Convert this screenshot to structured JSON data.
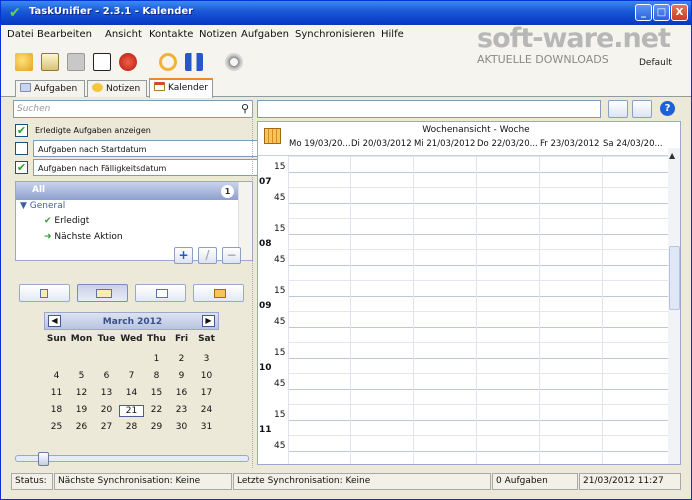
{
  "window": {
    "title": "TaskUnifier - 2.3.1 - Kalender",
    "buttons": [
      "_",
      "□",
      "X"
    ]
  },
  "menu": [
    "Datei",
    "Bearbeiten",
    "Ansicht",
    "Kontakte",
    "Notizen",
    "Aufgaben",
    "Synchronisieren",
    "Hilfe"
  ],
  "brand": {
    "logo": "soft-ware.net",
    "subtitle": "AKTUELLE DOWNLOADS",
    "profile": "Default"
  },
  "toolbar": {
    "icons": [
      "add-task-icon",
      "add-note-icon",
      "copy-icon",
      "edit-icon",
      "delete-icon",
      "sync-icon",
      "pause-icon",
      "settings-icon"
    ]
  },
  "tabs": [
    {
      "label": "Aufgaben"
    },
    {
      "label": "Notizen"
    },
    {
      "label": "Kalender"
    }
  ],
  "left": {
    "search_placeholder": "Suchen",
    "show_completed": "Erledigte Aufgaben anzeigen",
    "by_start": "Aufgaben nach Startdatum",
    "by_due": "Aufgaben nach Fälligkeitsdatum",
    "tree": {
      "all_label": "All",
      "all_count": "1",
      "group": "General",
      "items": [
        "Erledigt",
        "Nächste Aktion"
      ]
    },
    "actions": {
      "add": "+",
      "edit": "/",
      "remove": "−"
    }
  },
  "calendar": {
    "month": "March 2012",
    "weekdays": [
      "Sun",
      "Mon",
      "Tue",
      "Wed",
      "Thu",
      "Fri",
      "Sat"
    ],
    "weeks": [
      [
        "",
        "",
        "",
        "",
        "1",
        "2",
        "3"
      ],
      [
        "4",
        "5",
        "6",
        "7",
        "8",
        "9",
        "10"
      ],
      [
        "11",
        "12",
        "13",
        "14",
        "15",
        "16",
        "17"
      ],
      [
        "18",
        "19",
        "20",
        "21",
        "22",
        "23",
        "24"
      ],
      [
        "25",
        "26",
        "27",
        "28",
        "29",
        "30",
        "31"
      ]
    ],
    "today": "21"
  },
  "week": {
    "title": "Wochenansicht - Woche",
    "days": [
      "Mo 19/03/20...",
      "Di 20/03/2012",
      "Mi 21/03/2012",
      "Do 22/03/20...",
      "Fr 23/03/2012",
      "Sa 24/03/20..."
    ],
    "slots": [
      {
        "hour": "",
        "minute": "15"
      },
      {
        "hour": "07",
        "minute": "45"
      },
      {
        "hour": "",
        "minute": "15"
      },
      {
        "hour": "08",
        "minute": "45"
      },
      {
        "hour": "",
        "minute": "15"
      },
      {
        "hour": "09",
        "minute": "45"
      },
      {
        "hour": "",
        "minute": "15"
      },
      {
        "hour": "10",
        "minute": "45"
      },
      {
        "hour": "",
        "minute": "15"
      },
      {
        "hour": "11",
        "minute": "45"
      }
    ]
  },
  "status": {
    "label": "Status:",
    "next_sync": "Nächste Synchronisation: Keine",
    "last_sync": "Letzte Synchronisation: Keine",
    "tasks": "0 Aufgaben",
    "datetime": "21/03/2012 11:27"
  }
}
